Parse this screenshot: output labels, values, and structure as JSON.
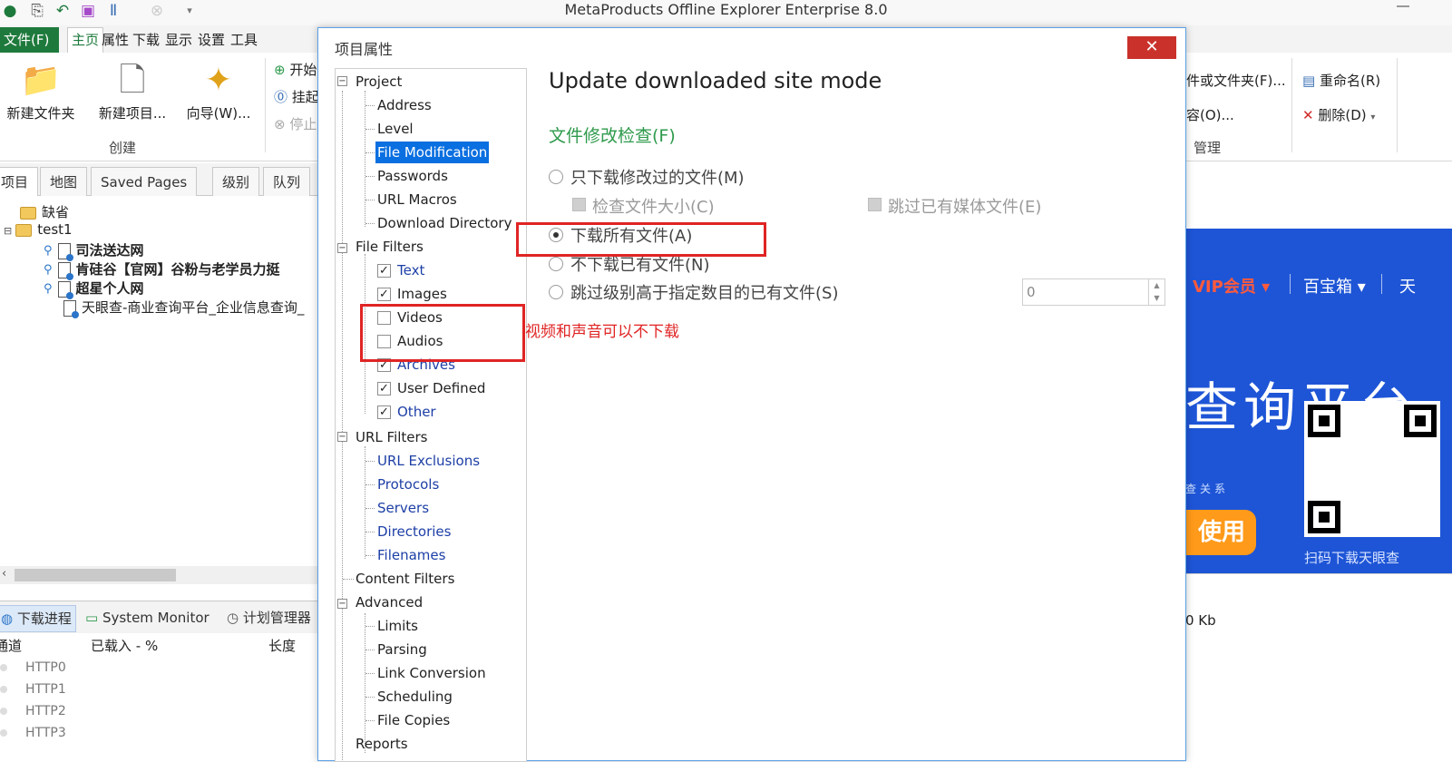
{
  "app": {
    "title": "MetaProducts Offline Explorer Enterprise 8.0",
    "file_tab": "文件(F)",
    "ribbon_tabs": [
      "主页",
      "属性",
      "下载",
      "显示",
      "设置",
      "工具"
    ]
  },
  "ribbon": {
    "create": {
      "new_folder": "新建文件夹",
      "new_project": "新建项目...",
      "wizard": "向导(W)...",
      "group_label": "创建"
    },
    "download": {
      "start": "开始",
      "pause": "挂起",
      "stop": "停止"
    },
    "manage": {
      "files_or_folders": "件或文件夹(F)...",
      "content": "容(O)...",
      "rename": "重命名(R)",
      "delete": "删除(D)",
      "group_label": "管理"
    }
  },
  "left_tabs": [
    "项目",
    "地图",
    "Saved Pages",
    "级别",
    "队列"
  ],
  "project_tree": [
    {
      "label": "缺省",
      "type": "folder"
    },
    {
      "label": "test1",
      "type": "folder"
    },
    {
      "label": "司法送达网",
      "type": "page",
      "bold": true
    },
    {
      "label": "肯硅谷【官网】谷粉与老学员力挺",
      "type": "page",
      "bold": true
    },
    {
      "label": "超星个人网",
      "type": "page",
      "bold": true
    },
    {
      "label": "天眼查-商业查询平台_企业信息查询_",
      "type": "page",
      "bold": false
    }
  ],
  "bottom_tabs": [
    "下载进程",
    "System Monitor",
    "计划管理器"
  ],
  "connections": {
    "headers": [
      "通道",
      "已载入 - %",
      "长度"
    ],
    "rows": [
      "HTTP0",
      "HTTP1",
      "HTTP2",
      "HTTP3"
    ]
  },
  "web_preview": {
    "vip": "VIP会员 ▾",
    "toolbox": "百宝箱 ▾",
    "sky": "天",
    "big_text": "查询平台",
    "use_button": "使用",
    "scan_text": "扫码下载天眼查",
    "small_text": "查关系"
  },
  "status": {
    "size": "0 Kb"
  },
  "dialog": {
    "title": "项目属性",
    "close": "✕",
    "tree": {
      "project": "Project",
      "address": "Address",
      "level": "Level",
      "file_modification": "File Modification",
      "passwords": "Passwords",
      "url_macros": "URL Macros",
      "download_directory": "Download Directory",
      "file_filters": "File Filters",
      "text": "Text",
      "images": "Images",
      "videos": "Videos",
      "audios": "Audios",
      "archives": "Archives",
      "user_defined": "User Defined",
      "other": "Other",
      "url_filters": "URL Filters",
      "url_exclusions": "URL Exclusions",
      "protocols": "Protocols",
      "servers": "Servers",
      "directories": "Directories",
      "filenames": "Filenames",
      "content_filters": "Content Filters",
      "advanced": "Advanced",
      "limits": "Limits",
      "parsing": "Parsing",
      "link_conversion": "Link Conversion",
      "scheduling": "Scheduling",
      "file_copies": "File Copies",
      "reports": "Reports"
    },
    "content": {
      "heading": "Update downloaded site mode",
      "section": "文件修改检查(F)",
      "opt_modified_only": "只下载修改过的文件(M)",
      "chk_file_size": "检查文件大小(C)",
      "chk_skip_media": "跳过已有媒体文件(E)",
      "opt_download_all": "下载所有文件(A)",
      "opt_skip_existing": "不下载已有文件(N)",
      "opt_skip_level": "跳过级别高于指定数目的已有文件(S)",
      "level_value": "0"
    },
    "annotation": "视频和声音可以不下载"
  },
  "colors": {
    "accent_green": "#1e7a3c",
    "selection_blue": "#0a6fe0",
    "annotation_red": "#e02424",
    "close_red": "#c9312a"
  }
}
